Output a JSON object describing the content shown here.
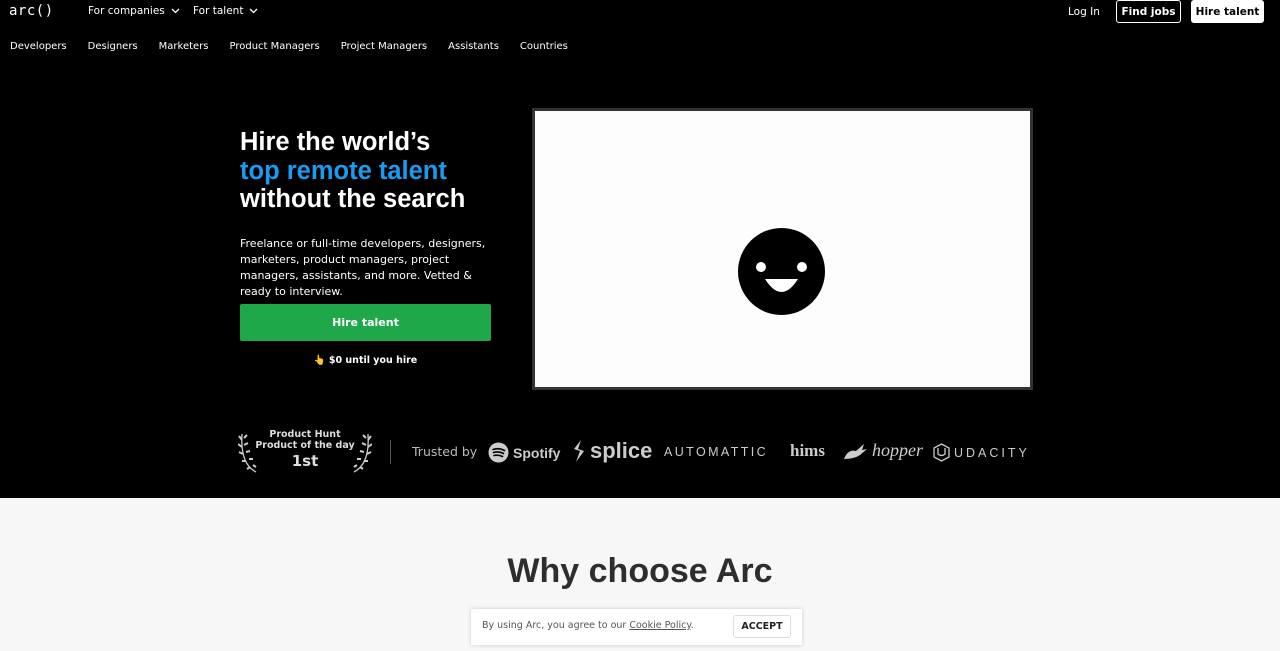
{
  "header": {
    "logo": "arc()",
    "menus": [
      {
        "label": "For companies"
      },
      {
        "label": "For talent"
      }
    ],
    "login": "Log In",
    "find_jobs": "Find jobs",
    "hire_talent": "Hire talent"
  },
  "subnav": [
    "Developers",
    "Designers",
    "Marketers",
    "Product Managers",
    "Project Managers",
    "Assistants",
    "Countries"
  ],
  "hero": {
    "headline_line1": "Hire the world’s",
    "headline_line2": "top remote talent",
    "headline_line3": "without the search",
    "description": "Freelance or full-time developers, designers, marketers, product managers, project managers, assistants, and more. Vetted & ready to interview.",
    "cta": "Hire talent",
    "note": "👆 $0 until you hire"
  },
  "badge": {
    "line1": "Product Hunt",
    "line2": "Product of the day",
    "rank": "1st"
  },
  "trusted_by": {
    "label": "Trusted by",
    "logos": [
      "Spotify",
      "splice",
      "AUTOMATTIC",
      "hims",
      "hopper",
      "UDACITY"
    ]
  },
  "section": {
    "title": "Why choose Arc"
  },
  "cookie": {
    "text": "By using Arc, you agree to our ",
    "link": "Cookie Policy",
    "end": ".",
    "accept": "ACCEPT"
  },
  "colors": {
    "hero_bg": "#000000",
    "accent_blue": "#1a9bf0",
    "cta_green": "#1ea84a"
  }
}
